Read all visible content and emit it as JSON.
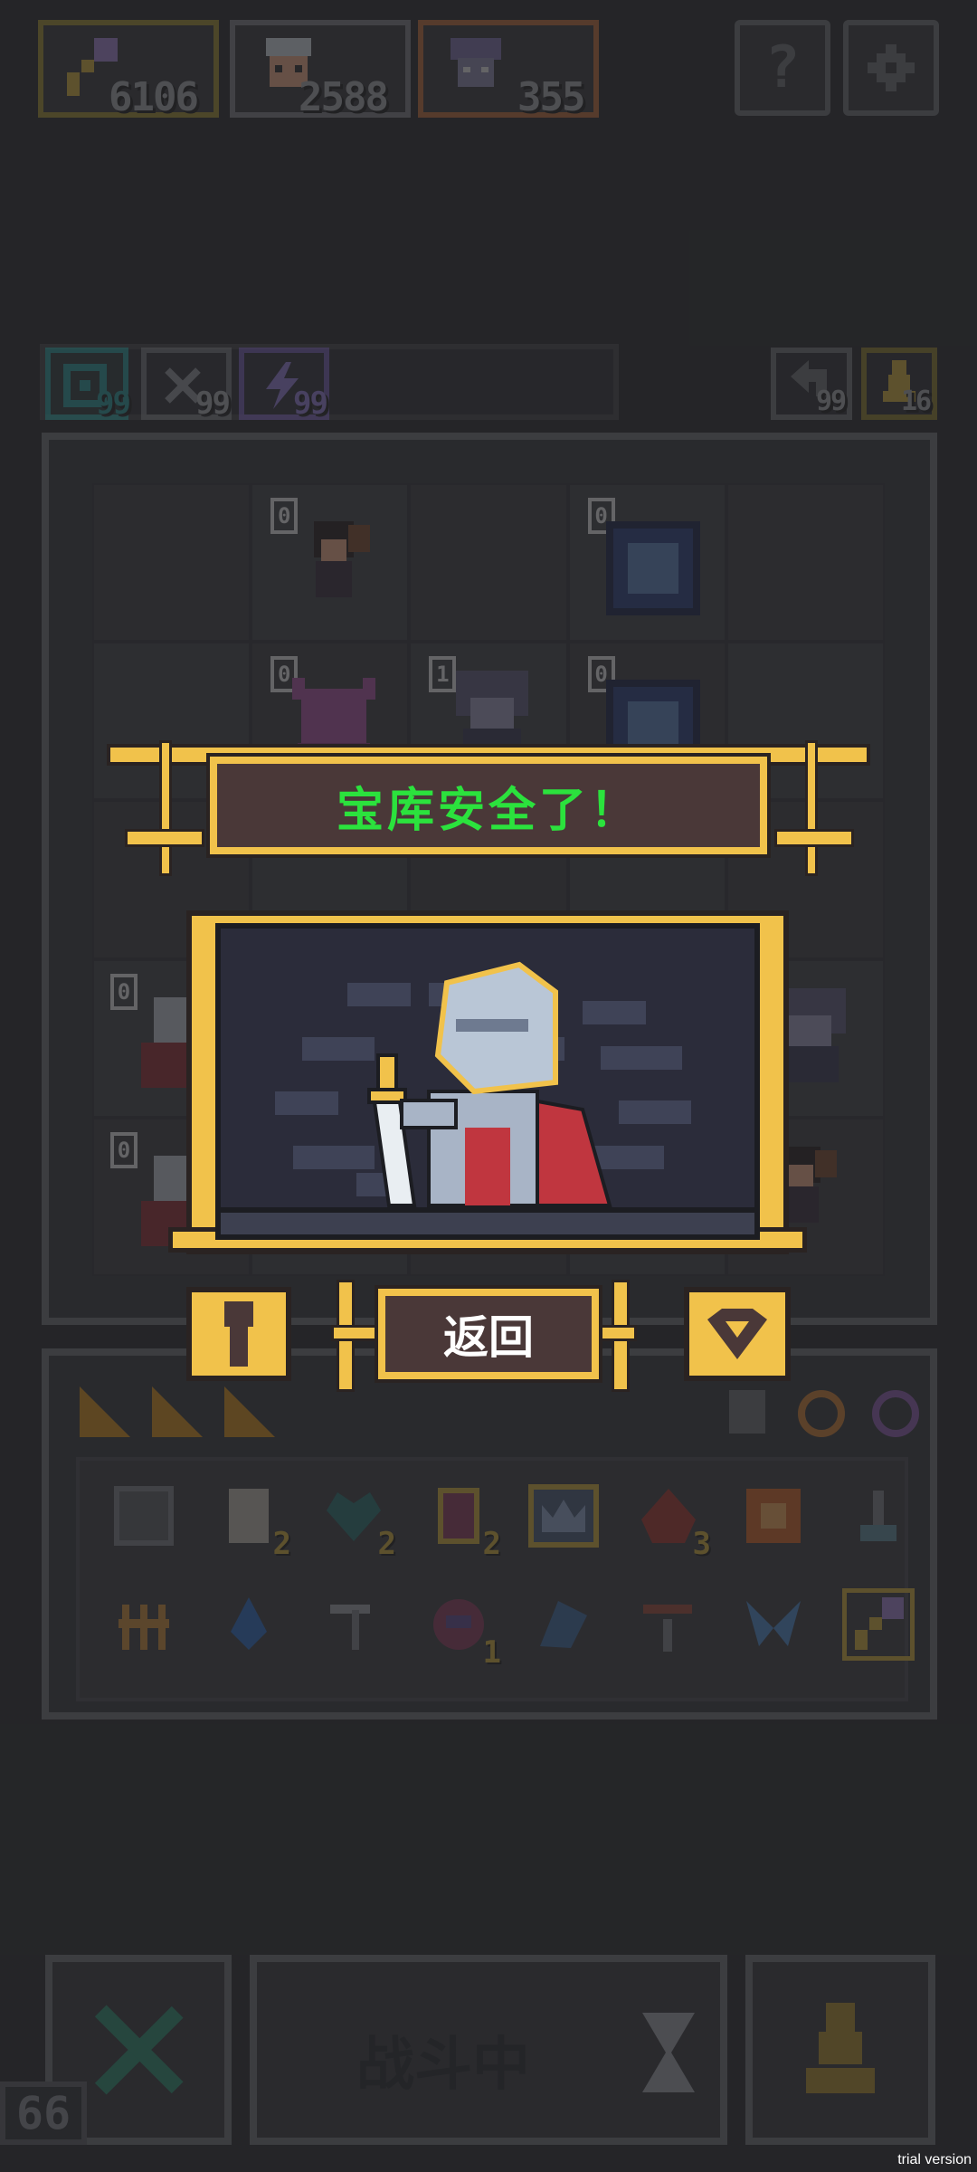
{
  "topbar": {
    "resources": [
      {
        "icon": "key-wand-icon",
        "value": "6106"
      },
      {
        "icon": "hero-portrait-icon",
        "value": "2588"
      },
      {
        "icon": "monster-portrait-icon",
        "value": "355"
      }
    ],
    "help_label": "?",
    "settings_icon": "gear-icon"
  },
  "status_row": {
    "abilities": [
      {
        "icon": "spiral-icon",
        "value": "99",
        "color": "#2b8f8c"
      },
      {
        "icon": "crossed-blades-icon",
        "value": "99",
        "color": "#7f7f7f"
      },
      {
        "icon": "lightning-icon",
        "value": "99",
        "color": "#6f5aa3"
      }
    ],
    "right_counters": [
      {
        "icon": "return-arrow-icon",
        "value": "99"
      },
      {
        "icon": "pawn-icon",
        "value": "16"
      }
    ]
  },
  "board": {
    "cell_counters": [
      "0",
      "0",
      "0",
      "1",
      "0",
      "0",
      "0"
    ]
  },
  "modal": {
    "title": "宝库安全了！",
    "back_button": "返回",
    "left_icon": "keyhole-icon",
    "right_icon": "gem-icon",
    "title_color": "#2be23d",
    "frame_color": "#f1c24b"
  },
  "inventory": {
    "row1_counts": [
      "2",
      "2",
      "2",
      "",
      "3",
      ""
    ],
    "row2_counts": [
      "",
      "",
      "",
      "1",
      "",
      "",
      "",
      ""
    ]
  },
  "bottom": {
    "cancel_icon": "cross-icon",
    "status_text": "战斗中",
    "hourglass_icon": "hourglass-icon",
    "pawn_icon": "pawn-icon",
    "corner_number": "66"
  },
  "watermark": "trial version"
}
